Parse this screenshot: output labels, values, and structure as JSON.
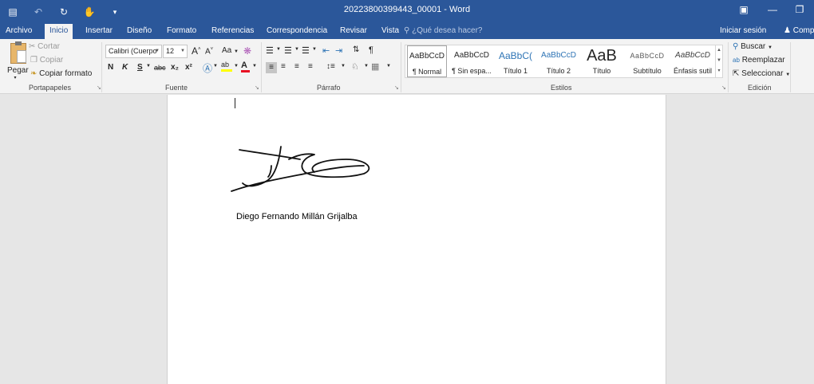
{
  "window": {
    "title": "20223800399443_00001 - Word",
    "qat_icons": [
      "save-icon",
      "undo-icon",
      "redo-icon",
      "touch-mode-icon",
      "customize-qat-icon"
    ],
    "controls": [
      "ribbon-display-icon",
      "minimize-icon",
      "restore-icon"
    ]
  },
  "tabs": [
    {
      "label": "Archivo"
    },
    {
      "label": "Inicio",
      "active": true
    },
    {
      "label": "Insertar"
    },
    {
      "label": "Diseño"
    },
    {
      "label": "Formato"
    },
    {
      "label": "Referencias"
    },
    {
      "label": "Correspondencia"
    },
    {
      "label": "Revisar"
    },
    {
      "label": "Vista"
    }
  ],
  "tell_me": "¿Qué desea hacer?",
  "account": {
    "sign_in": "Iniciar sesión",
    "share": "Comp"
  },
  "ribbon": {
    "clipboard": {
      "label": "Portapapeles",
      "paste": "Pegar",
      "cut": "Cortar",
      "copy": "Copiar",
      "format_painter": "Copiar formato"
    },
    "font": {
      "label": "Fuente",
      "font_name": "Calibri (Cuerpo",
      "font_size": "12",
      "bold": "N",
      "italic": "K",
      "underline": "S",
      "strike": "abc",
      "subscript": "x₂",
      "superscript": "x²",
      "change_case": "Aa",
      "grow": "A",
      "shrink": "A"
    },
    "paragraph": {
      "label": "Párrafo",
      "pilcrow": "¶"
    },
    "styles": {
      "label": "Estilos",
      "items": [
        {
          "preview": "AaBbCcD",
          "name": "¶ Normal",
          "selected": true
        },
        {
          "preview": "AaBbCcD",
          "name": "¶ Sin espa..."
        },
        {
          "preview": "AaBbC(",
          "name": "Título 1"
        },
        {
          "preview": "AaBbCcD",
          "name": "Título 2"
        },
        {
          "preview": "AaB",
          "name": "Título"
        },
        {
          "preview": "AaBbCcD",
          "name": "Subtítulo"
        },
        {
          "preview": "AaBbCcD",
          "name": "Énfasis sutil"
        }
      ],
      "accent_color": "#2e74b5"
    },
    "editing": {
      "label": "Edición",
      "find": "Buscar",
      "replace": "Reemplazar",
      "select": "Seleccionar"
    }
  },
  "document": {
    "signer_name": "Diego Fernando Millán Grijalba"
  }
}
